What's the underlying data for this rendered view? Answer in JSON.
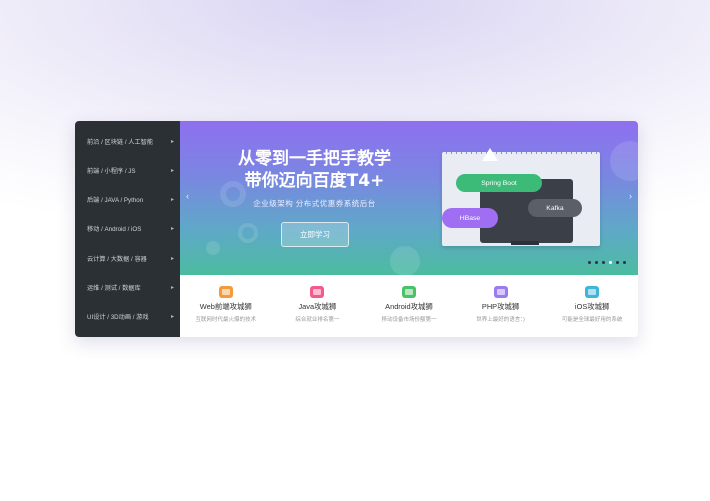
{
  "sidebar": {
    "items": [
      {
        "label": "前沿 / 区块链 / 人工智能"
      },
      {
        "label": "前端 / 小程序 / JS"
      },
      {
        "label": "后端 / JAVA / Python"
      },
      {
        "label": "移动 / Android / iOS"
      },
      {
        "label": "云计算 / 大数据 / 容器"
      },
      {
        "label": "运维 / 测试 / 数据库"
      },
      {
        "label": "UI设计 / 3D动画 / 游戏"
      }
    ],
    "arrow": "▸"
  },
  "banner": {
    "title_line1": "从零到一手把手教学",
    "title_line2": "带你迈向百度T4+",
    "subtitle": "企业级架构   分布式优惠券系统后台",
    "cta_label": "立即学习",
    "prev_arrow": "‹",
    "next_arrow": "›",
    "bubbles": {
      "spring": "Spring Boot",
      "kafka": "Kafka",
      "hbase": "HBase"
    },
    "slide_count": 6,
    "active_slide": 3
  },
  "courses": [
    {
      "name": "Web前端攻城狮",
      "desc": "互联网时代最火爆的技术",
      "color": "#f39a3c"
    },
    {
      "name": "Java攻城狮",
      "desc": "综合就业排名第一",
      "color": "#f25a8a"
    },
    {
      "name": "Android攻城狮",
      "desc": "移动设备市场份额第一",
      "color": "#4cc168"
    },
    {
      "name": "PHP攻城狮",
      "desc": "世界上最好的语言：)",
      "color": "#9b7cf0"
    },
    {
      "name": "iOS攻城狮",
      "desc": "可能是全球最好用的系统",
      "color": "#3fb6d8"
    }
  ]
}
